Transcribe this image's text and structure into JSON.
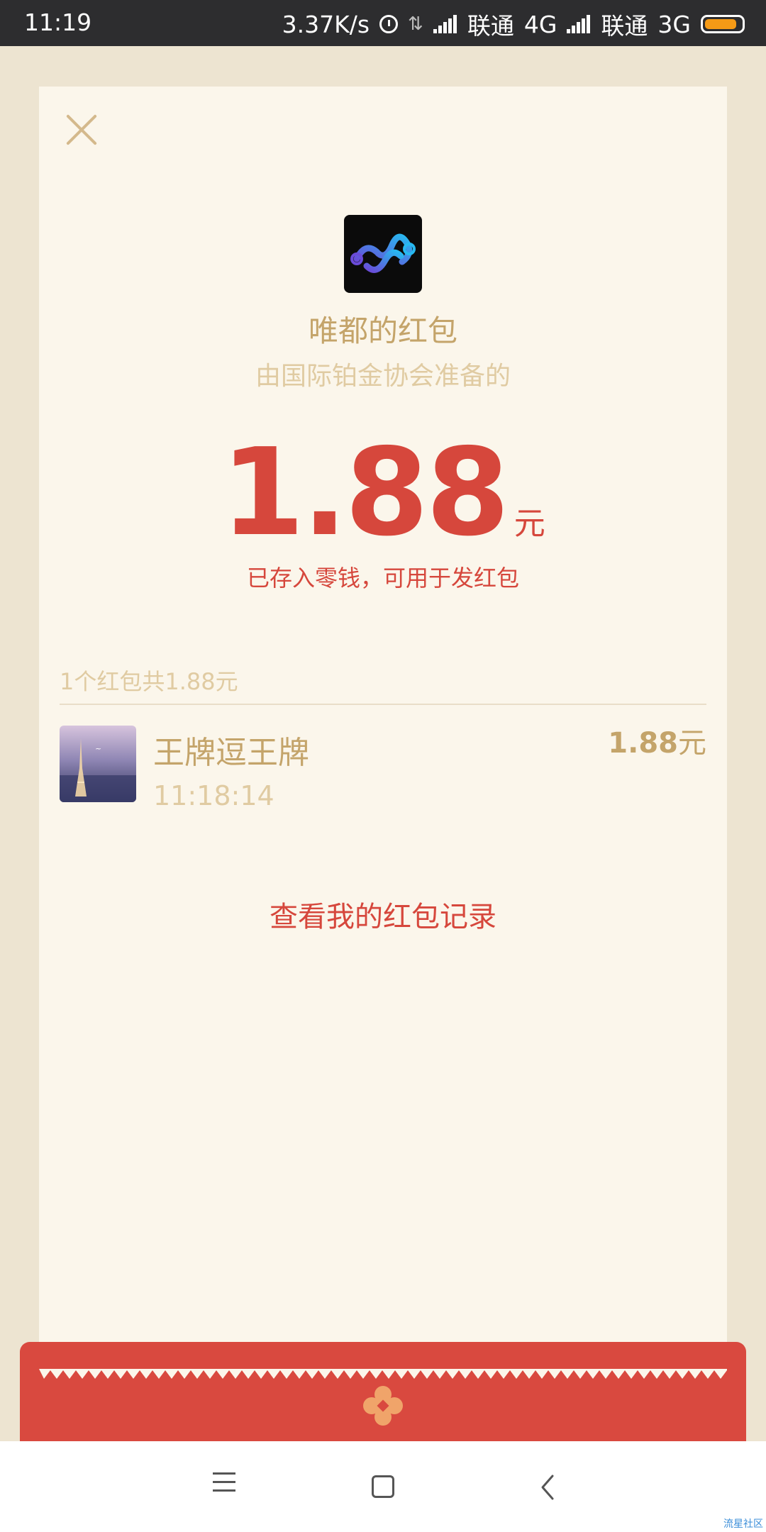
{
  "status_bar": {
    "time": "11:19",
    "network_speed": "3.37K/s",
    "carrier1": "联通",
    "net1": "4G",
    "carrier2": "联通",
    "net2": "3G",
    "battery_level": 0.9,
    "battery_color": "#f59a16"
  },
  "card": {
    "sender_name": "唯都的红包",
    "sender_org": "由国际铂金协会准备的",
    "amount": "1.88",
    "amount_unit": "元",
    "note": "已存入零钱，可用于发红包",
    "summary": "1个红包共1.88元"
  },
  "records": [
    {
      "name": "王牌逗王牌",
      "time": "11:18:14",
      "amount": "1.88",
      "unit": "元"
    }
  ],
  "history_link": "查看我的红包记录",
  "watermark": "流星社区",
  "colors": {
    "accent_red": "#d6473c",
    "gold": "#c4a46a",
    "envelope_red": "#d9493f",
    "card_bg": "#fbf6eb"
  }
}
